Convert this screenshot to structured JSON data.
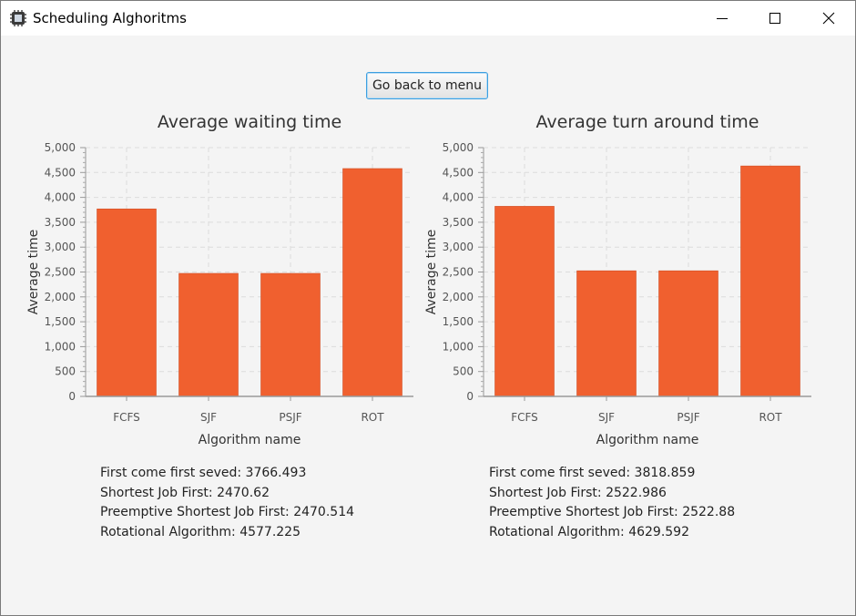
{
  "window": {
    "title": "Scheduling Alghoritms"
  },
  "controls": {
    "back_button": "Go back to menu"
  },
  "chart_data": [
    {
      "type": "bar",
      "title": "Average waiting time",
      "xlabel": "Algorithm name",
      "ylabel": "Average time",
      "categories": [
        "FCFS",
        "SJF",
        "PSJF",
        "ROT"
      ],
      "values": [
        3766.493,
        2470.62,
        2470.514,
        4577.225
      ],
      "ylim": [
        0,
        5000
      ],
      "yticks": [
        0,
        500,
        1000,
        1500,
        2000,
        2500,
        3000,
        3500,
        4000,
        4500,
        5000
      ],
      "ytick_labels": [
        "0",
        "500",
        "1,000",
        "1,500",
        "2,000",
        "2,500",
        "3,000",
        "3,500",
        "4,000",
        "4,500",
        "5,000"
      ],
      "grid": true,
      "bar_color": "#f0602f"
    },
    {
      "type": "bar",
      "title": "Average turn around time",
      "xlabel": "Algorithm name",
      "ylabel": "Average time",
      "categories": [
        "FCFS",
        "SJF",
        "PSJF",
        "ROT"
      ],
      "values": [
        3818.859,
        2522.986,
        2522.88,
        4629.592
      ],
      "ylim": [
        0,
        5000
      ],
      "yticks": [
        0,
        500,
        1000,
        1500,
        2000,
        2500,
        3000,
        3500,
        4000,
        4500,
        5000
      ],
      "ytick_labels": [
        "0",
        "500",
        "1,000",
        "1,500",
        "2,000",
        "2,500",
        "3,000",
        "3,500",
        "4,000",
        "4,500",
        "5,000"
      ],
      "grid": true,
      "bar_color": "#f0602f"
    }
  ],
  "summaries": {
    "left": [
      "First come first seved: 3766.493",
      "Shortest Job First: 2470.62",
      "Preemptive Shortest Job First: 2470.514",
      "Rotational Algorithm: 4577.225"
    ],
    "right": [
      "First come first seved: 3818.859",
      "Shortest Job First: 2522.986",
      "Preemptive Shortest Job First: 2522.88",
      "Rotational Algorithm: 4629.592"
    ]
  }
}
